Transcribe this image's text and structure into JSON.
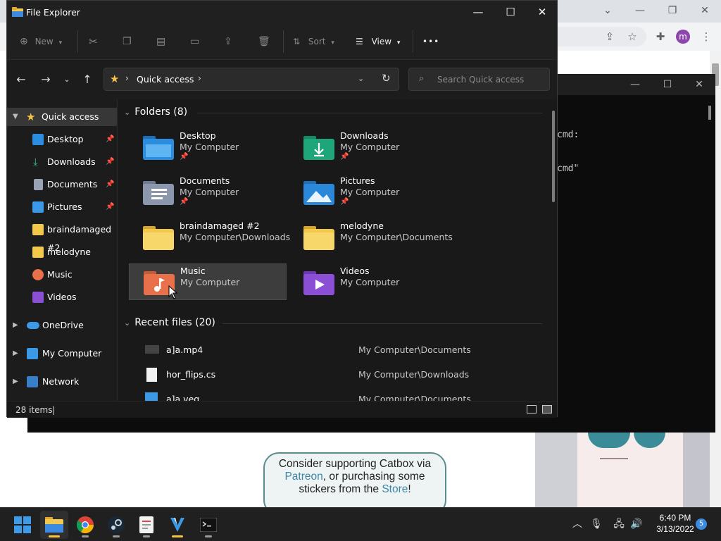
{
  "explorer": {
    "title": "File Explorer",
    "window_controls": {
      "minimize": "—",
      "maximize": "☐",
      "close": "✕"
    },
    "command_bar": {
      "new_label": "New",
      "sort_label": "Sort",
      "view_label": "View",
      "more": "•••"
    },
    "address": {
      "location": "Quick access",
      "separator": "›"
    },
    "search": {
      "placeholder": "Search Quick access"
    },
    "sidebar": [
      {
        "label": "Quick access",
        "icon": "star-icon",
        "selected": true
      },
      {
        "label": "Desktop",
        "icon": "desktop-folder-icon",
        "pinned": true
      },
      {
        "label": "Downloads",
        "icon": "download-icon",
        "pinned": true
      },
      {
        "label": "Documents",
        "icon": "documents-icon",
        "pinned": true
      },
      {
        "label": "Pictures",
        "icon": "pictures-icon",
        "pinned": true
      },
      {
        "label": "braindamaged #2",
        "icon": "folder-icon"
      },
      {
        "label": "melodyne",
        "icon": "folder-icon"
      },
      {
        "label": "Music",
        "icon": "music-icon"
      },
      {
        "label": "Videos",
        "icon": "videos-icon"
      },
      {
        "label": "OneDrive",
        "icon": "cloud-icon"
      },
      {
        "label": "My Computer",
        "icon": "computer-icon"
      },
      {
        "label": "Network",
        "icon": "network-icon"
      }
    ],
    "folders_header": "Folders (8)",
    "folders": [
      {
        "name": "Desktop",
        "location": "My Computer",
        "pinned": true,
        "color": "#2a8de0"
      },
      {
        "name": "Downloads",
        "location": "My Computer",
        "pinned": true,
        "color": "#1fa57a"
      },
      {
        "name": "Documents",
        "location": "My Computer",
        "pinned": true,
        "color": "#8a97ad"
      },
      {
        "name": "Pictures",
        "location": "My Computer",
        "pinned": true,
        "color": "#2b87d8"
      },
      {
        "name": "braindamaged #2",
        "location": "My Computer\\Downloads",
        "color": "#f2c94c"
      },
      {
        "name": "melodyne",
        "location": "My Computer\\Documents",
        "color": "#f2c94c"
      },
      {
        "name": "Music",
        "location": "My Computer",
        "selected": true,
        "color": "#e8704a"
      },
      {
        "name": "Videos",
        "location": "My Computer",
        "color": "#8b4fd6"
      }
    ],
    "recent_header": "Recent files (20)",
    "recent_files": [
      {
        "name": "a]a.mp4",
        "location": "My Computer\\Documents",
        "icon": "video-file-icon"
      },
      {
        "name": "hor_flips.cs",
        "location": "My Computer\\Downloads",
        "icon": "document-file-icon"
      },
      {
        "name": "a]a.veg",
        "location": "My Computer\\Documents",
        "icon": "vegas-file-icon"
      }
    ],
    "status": {
      "items": "28 items",
      "separator": "|"
    }
  },
  "terminal": {
    "line1": "cmd:",
    "line2": "cmd\""
  },
  "catbox": {
    "line1": "Consider supporting Catbox via",
    "patreon": "Patreon",
    "line2_rest": ", or purchasing some",
    "line3_pre": "stickers from the ",
    "store": "Store",
    "line3_post": "!"
  },
  "taskbar": {
    "apps": [
      "start-icon",
      "file-explorer-icon",
      "chrome-icon",
      "steam-icon",
      "notepad-icon",
      "vegas-icon",
      "terminal-icon"
    ],
    "time": "6:40 PM",
    "date": "3/13/2022",
    "notifications": "5"
  },
  "chrome": {
    "avatar_letter": "m"
  }
}
